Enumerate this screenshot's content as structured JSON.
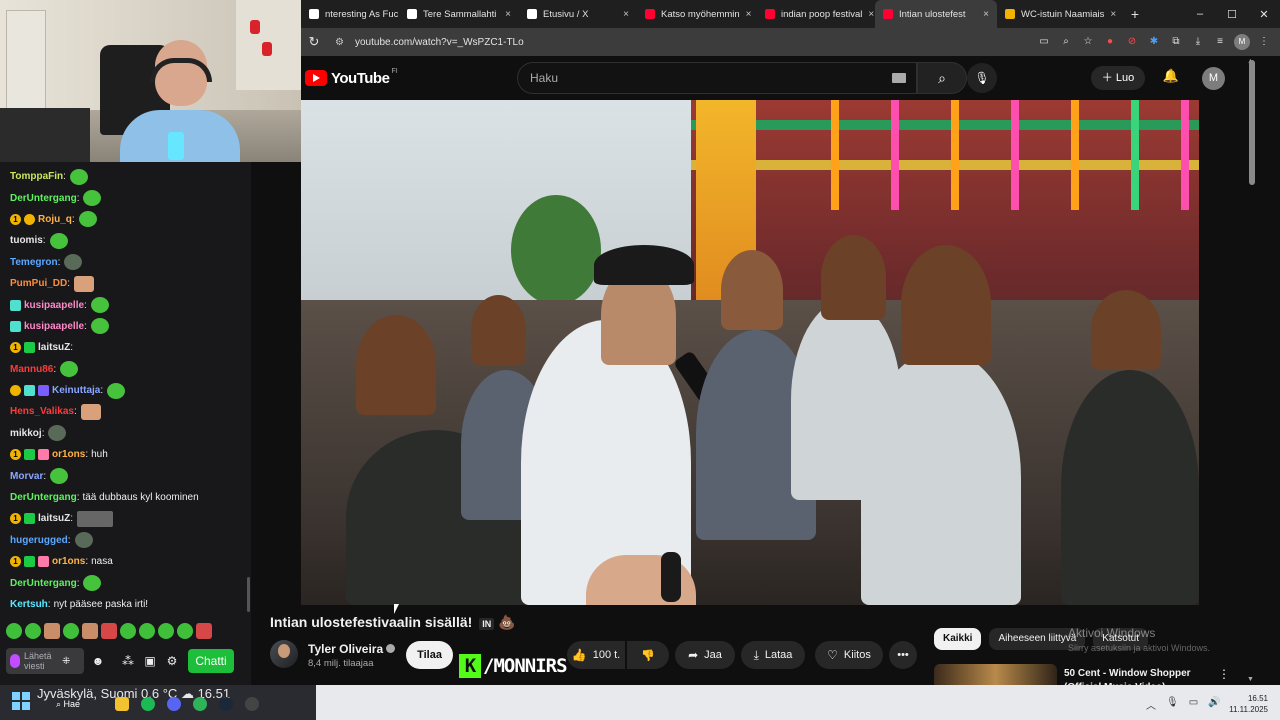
{
  "browser": {
    "tabs": [
      {
        "label": "nteresting As Fuck",
        "favicon_color": "#ffffff",
        "active": false
      },
      {
        "label": "Tere Sammallahti",
        "favicon_color": "#ffffff",
        "active": false
      },
      {
        "label": "Etusivu / X",
        "favicon_color": "#ffffff",
        "active": false
      },
      {
        "label": "Katso myöhemmin",
        "favicon_color": "#ff0033",
        "active": false
      },
      {
        "label": "indian poop festival",
        "favicon_color": "#ff0033",
        "active": false
      },
      {
        "label": "Intian ulostefest",
        "favicon_color": "#ff0033",
        "active": true
      },
      {
        "label": "WC-istuin Naamiais",
        "favicon_color": "#f2b400",
        "active": false
      }
    ],
    "tab_close": "×",
    "new_tab": "+",
    "window_controls": {
      "minimize": "–",
      "maximize": "☐",
      "close": "✕"
    },
    "url": "youtube.com/watch?v=_WsPZC1-TLo"
  },
  "youtube": {
    "logo_text": "YouTube",
    "region": "FI",
    "search_placeholder": "Haku",
    "create_label": "Luo",
    "avatar_letter": "M",
    "video_title": "Intian ulostefestivaalin sisällä!",
    "video_title_tag": "IN",
    "channel_name": "Tyler Oliveira",
    "channel_subs": "8,4 milj. tilaajaa",
    "subscribe_label": "Tilaa",
    "like_count": "100 t.",
    "share_label": "Jaa",
    "download_label": "Lataa",
    "thanks_label": "Kiitos",
    "more_label": "•••",
    "chips": [
      "Kaikki",
      "Aiheeseen liittyvä",
      "Katsotut"
    ],
    "recommendation_title": "50 Cent - Window Shopper",
    "recommendation_subtitle": "(Official Music Video)",
    "watermark": "/MONNIRS"
  },
  "windows_activation": {
    "title": "Aktivoi Windows",
    "subtitle": "Siirry asetuksiin ja aktivoi Windows."
  },
  "chat": {
    "messages": [
      {
        "user": "TomppaFin",
        "color": "#c9e85a",
        "badges": [],
        "text": "",
        "emote": "green"
      },
      {
        "user": "DerUntergang",
        "color": "#5ff25f",
        "badges": [],
        "text": "",
        "emote": "green"
      },
      {
        "user": "Roju_q",
        "color": "#ffb347",
        "badges": [
          "gold",
          "gold2"
        ],
        "text": "",
        "emote": "green"
      },
      {
        "user": "tuomis",
        "color": "#e6e6e6",
        "badges": [],
        "text": "",
        "emote": "green"
      },
      {
        "user": "Temegron",
        "color": "#5aa8ff",
        "badges": [],
        "text": "",
        "emote": "dark"
      },
      {
        "user": "PumPui_DD",
        "color": "#ff8c3a",
        "badges": [],
        "text": "",
        "emote": "face"
      },
      {
        "user": "kusipaapelle",
        "color": "#ff88c8",
        "badges": [
          "teal"
        ],
        "text": "",
        "emote": "green"
      },
      {
        "user": "kusipaapelle",
        "color": "#ff88c8",
        "badges": [
          "teal"
        ],
        "text": "",
        "emote": "green"
      },
      {
        "user": "laitsuZ",
        "color": "#e6e6e6",
        "badges": [
          "gold",
          "green"
        ],
        "text": "",
        "emote": ""
      },
      {
        "user": "Mannu86",
        "color": "#ff3a3a",
        "badges": [],
        "text": "",
        "emote": "green"
      },
      {
        "user": "Keinuttaja",
        "color": "#8aa6ff",
        "badges": [
          "gold2",
          "teal",
          "purple"
        ],
        "text": "",
        "emote": "green"
      },
      {
        "user": "Hens_Valikas",
        "color": "#ff3a3a",
        "badges": [],
        "text": "",
        "emote": "face"
      },
      {
        "user": "mikkoj",
        "color": "#e6e6e6",
        "badges": [],
        "text": "",
        "emote": "dark"
      },
      {
        "user": "or1ons",
        "color": "#ffb347",
        "badges": [
          "gold",
          "green",
          "pink"
        ],
        "text": "huh",
        "emote": ""
      },
      {
        "user": "Morvar",
        "color": "#8aa6ff",
        "badges": [],
        "text": "",
        "emote": "green"
      },
      {
        "user": "DerUntergang",
        "color": "#5ff25f",
        "badges": [],
        "text": "tää dubbaus kyl koominen",
        "emote": ""
      },
      {
        "user": "laitsuZ",
        "color": "#e6e6e6",
        "badges": [
          "gold",
          "green"
        ],
        "text": "",
        "emote": "pic"
      },
      {
        "user": "hugerugged",
        "color": "#5aa8ff",
        "badges": [],
        "text": "",
        "emote": "dark"
      },
      {
        "user": "or1ons",
        "color": "#ffb347",
        "badges": [
          "gold",
          "green",
          "pink"
        ],
        "text": "nasa",
        "emote": ""
      },
      {
        "user": "DerUntergang",
        "color": "#5ff25f",
        "badges": [],
        "text": "",
        "emote": "green"
      },
      {
        "user": "Kertsuh",
        "color": "#5aeaff",
        "badges": [],
        "text": "nyt pääsee paska irti!",
        "emote": ""
      }
    ],
    "input_placeholder": "Lähetä viesti",
    "send_label": "Chatti"
  },
  "taskbar": {
    "weather": "Jyväskylä, Suomi   0,6 °C",
    "weather_time": "16.51",
    "search_label": "Hae",
    "time": "16.51",
    "date": "11.11.2025"
  }
}
